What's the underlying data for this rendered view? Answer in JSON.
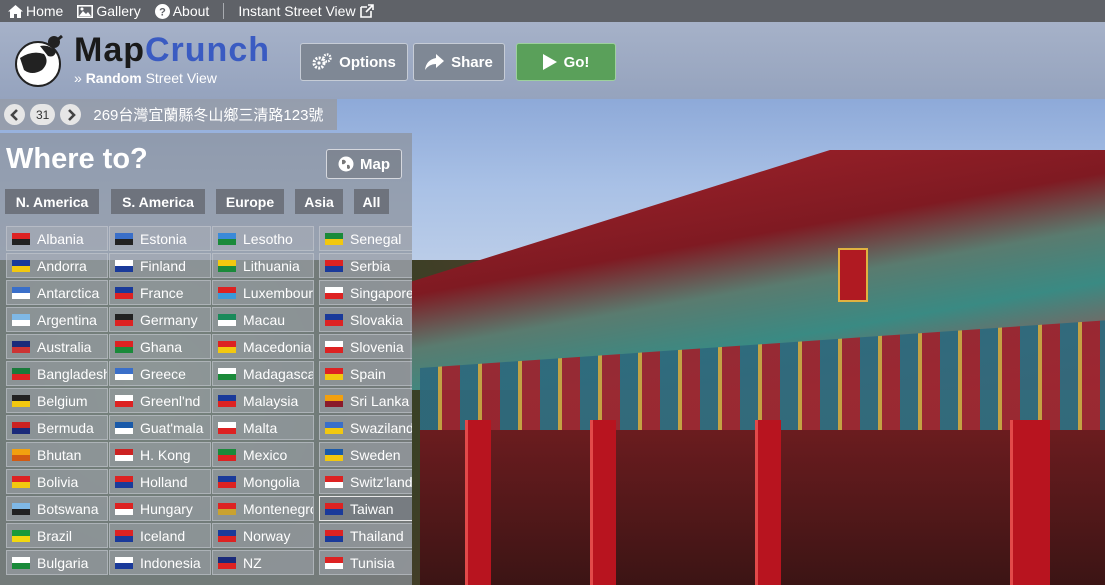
{
  "nav": {
    "home": "Home",
    "gallery": "Gallery",
    "about": "About",
    "instant": "Instant Street View"
  },
  "header": {
    "brand_a": "Map",
    "brand_b": "Crunch",
    "tag_prefix": "» ",
    "tag_bold": "Random",
    "tag_rest": " Street View",
    "options": "Options",
    "share": "Share",
    "go": "Go!"
  },
  "location": {
    "count": "31",
    "address": "269台灣宜蘭縣冬山鄉三清路123號"
  },
  "panel": {
    "title": "Where to?",
    "map_button": "Map",
    "regions": [
      "N. America",
      "S. America",
      "Europe",
      "Asia",
      "All"
    ]
  },
  "countries": {
    "col1": [
      "Albania",
      "Andorra",
      "Antarctica",
      "Argentina",
      "Australia",
      "Bangladesh",
      "Belgium",
      "Bermuda",
      "Bhutan",
      "Bolivia",
      "Botswana",
      "Brazil",
      "Bulgaria"
    ],
    "col2": [
      "Estonia",
      "Finland",
      "France",
      "Germany",
      "Ghana",
      "Greece",
      "Greenl'nd",
      "Guat'mala",
      "H. Kong",
      "Holland",
      "Hungary",
      "Iceland",
      "Indonesia"
    ],
    "col3": [
      "Lesotho",
      "Lithuania",
      "Luxembourg",
      "Macau",
      "Macedonia",
      "Madagascar",
      "Malaysia",
      "Malta",
      "Mexico",
      "Mongolia",
      "Montenegro",
      "Norway",
      "NZ"
    ],
    "col4": [
      "Senegal",
      "Serbia",
      "Singapore",
      "Slovakia",
      "Slovenia",
      "Spain",
      "Sri Lanka",
      "Swaziland",
      "Sweden",
      "Switz'land",
      "Taiwan",
      "Thailand",
      "Tunisia"
    ]
  },
  "colors": {
    "nav_bg": "#5f6268",
    "brand_blue": "#3a5bc2",
    "go_green": "#5aa05a"
  }
}
